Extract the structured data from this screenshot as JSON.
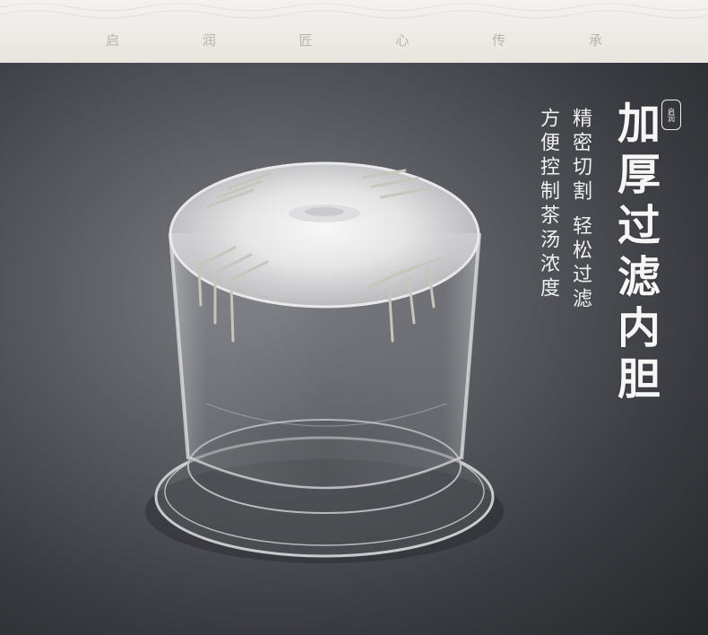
{
  "banner": {
    "slogan": "启 润 匠 心 传 承"
  },
  "brand_seal": "启润",
  "headline": "加厚过滤内胆",
  "feature_lines": [
    "精密切割 轻松过滤",
    "方便控制茶汤浓度"
  ],
  "colors": {
    "banner_bg": "#f0eee9",
    "background": "#3e3f44",
    "text": "#f4f4f4"
  }
}
